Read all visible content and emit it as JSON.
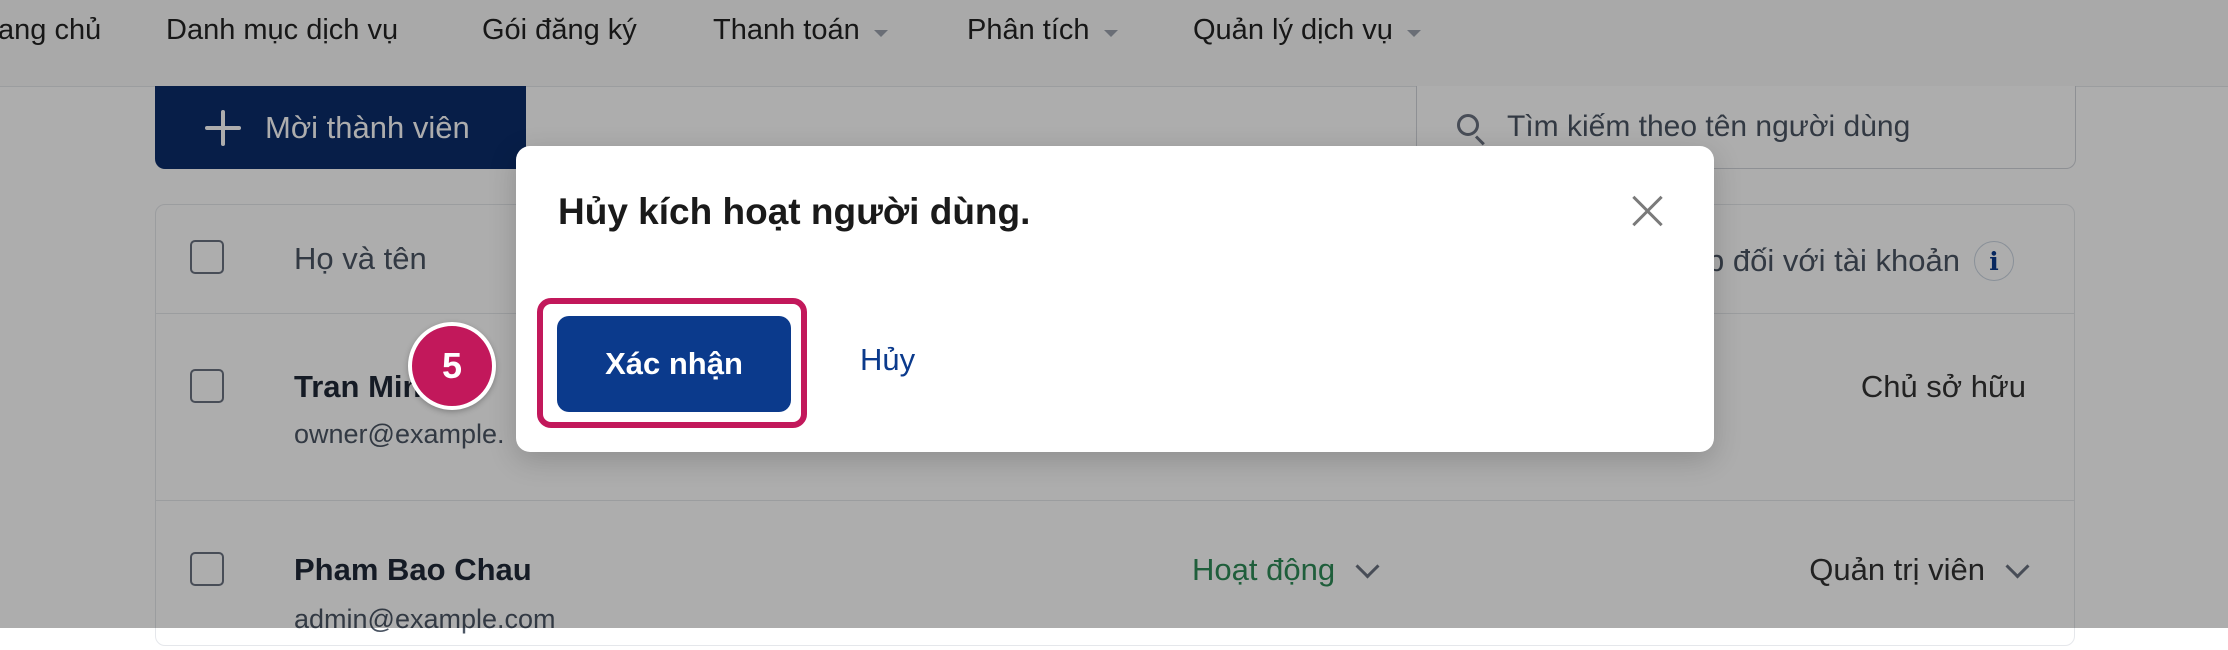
{
  "nav": {
    "items": [
      {
        "label": "ang chủ",
        "dropdown": false
      },
      {
        "label": "Danh mục dịch vụ",
        "dropdown": false
      },
      {
        "label": "Gói đăng ký",
        "dropdown": false
      },
      {
        "label": "Thanh toán",
        "dropdown": true
      },
      {
        "label": "Phân tích",
        "dropdown": true
      },
      {
        "label": "Quản lý dịch vụ",
        "dropdown": true
      }
    ]
  },
  "toolbar": {
    "invite_label": "Mời thành viên",
    "search_placeholder": "Tìm kiếm theo tên người dùng"
  },
  "table": {
    "headers": {
      "name": "Họ và tên",
      "role": "p đối với tài khoản"
    },
    "rows": [
      {
        "name": "Tran Min",
        "email": "owner@example.",
        "status": "",
        "role": "Chủ sở hữu"
      },
      {
        "name": "Pham Bao Chau",
        "email": "admin@example.com",
        "status": "Hoạt động",
        "role": "Quản trị viên"
      }
    ]
  },
  "modal": {
    "title": "Hủy kích hoạt người dùng.",
    "confirm_label": "Xác nhận",
    "cancel_label": "Hủy"
  },
  "annotation": {
    "step_number": "5"
  },
  "colors": {
    "primary": "#0b3a8c",
    "highlight": "#c2185b",
    "status_active": "#2e8b57"
  }
}
